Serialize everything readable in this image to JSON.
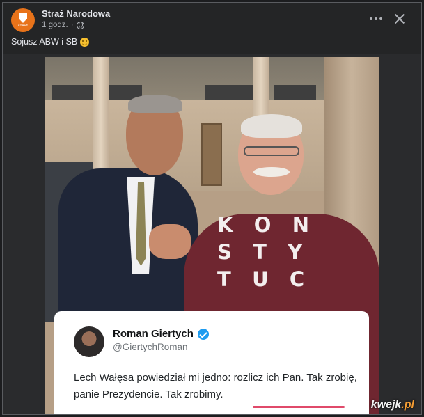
{
  "post": {
    "page_name": "Straż Narodowa",
    "time": "1 godz.",
    "caption": "Sojusz ABW i SB",
    "caption_emoji": "grinning-face-emoji"
  },
  "photo": {
    "sweater_text": [
      "KON",
      "STY",
      "TUC"
    ],
    "tweet": {
      "name": "Roman Giertych",
      "handle": "@GiertychRoman",
      "text": "Lech Wałęsa powiedział mi jedno: rozlicz ich Pan. Tak zrobię, panie Prezydencie. Tak zrobimy."
    },
    "watermark": {
      "main": "kwejk",
      "suffix": ".pl"
    }
  },
  "colors": {
    "background": "#242526",
    "avatar": "#e8731a",
    "verified": "#1d9bf0",
    "underline": "#e04a6a"
  }
}
